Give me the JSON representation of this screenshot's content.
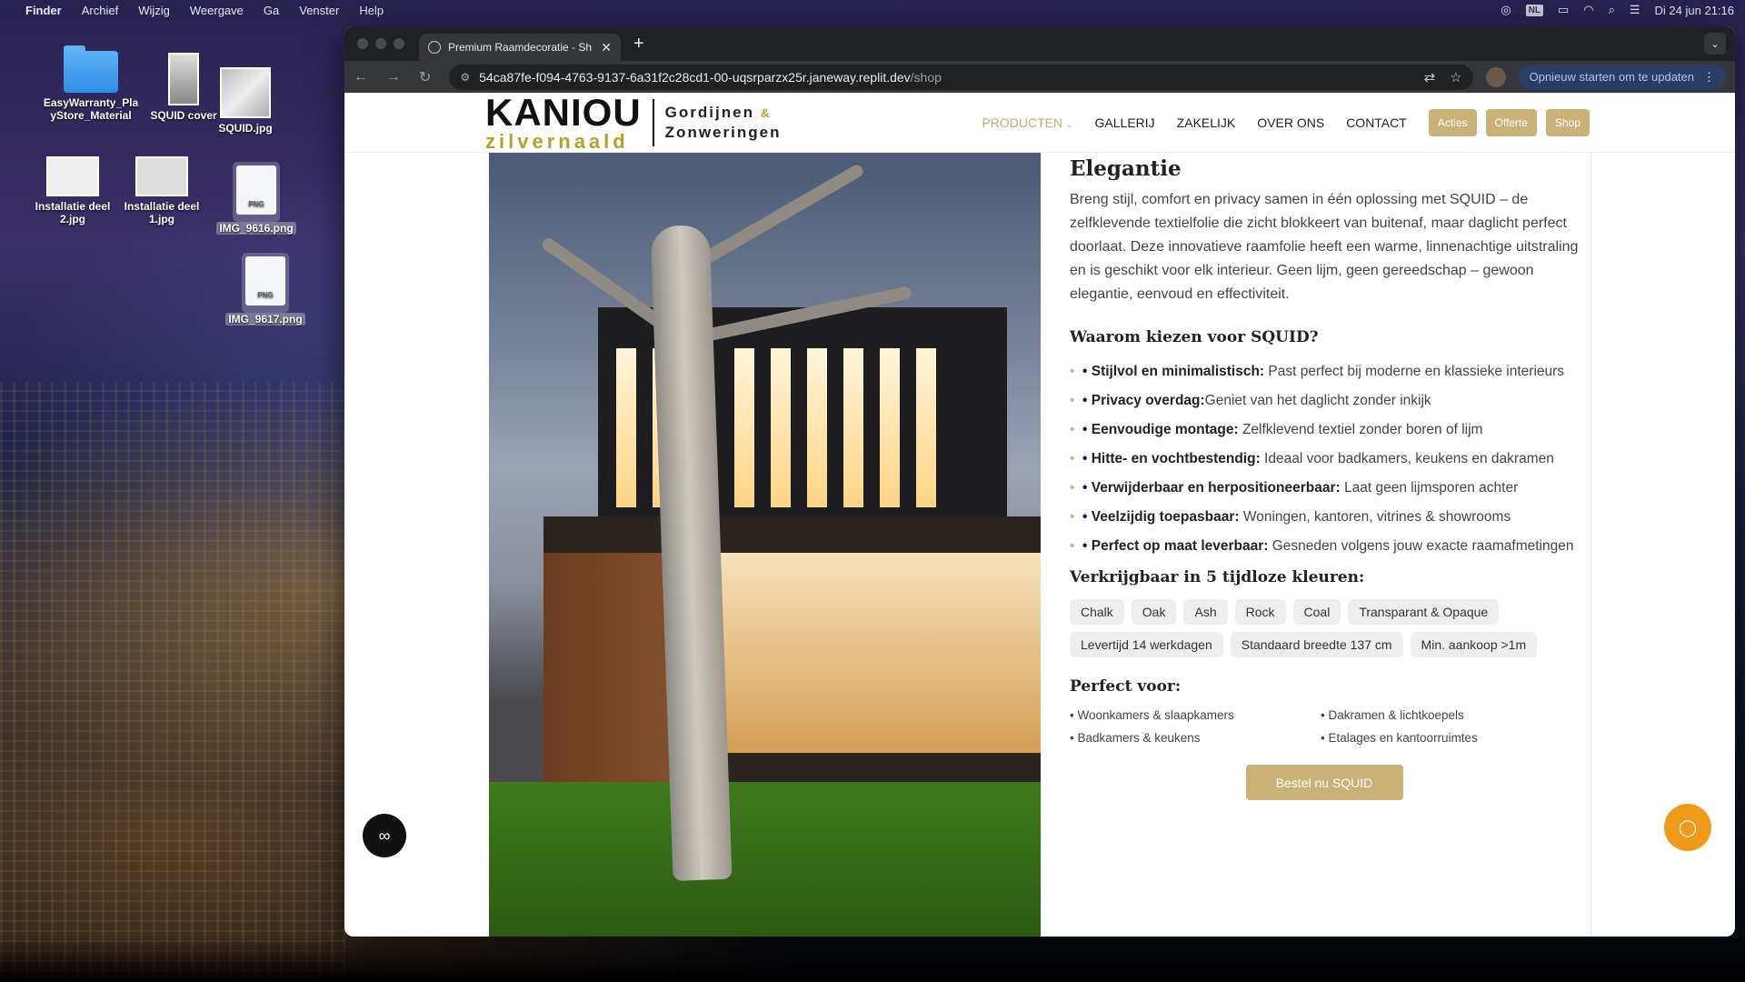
{
  "menubar": {
    "app": "Finder",
    "items": [
      "Archief",
      "Wijzig",
      "Weergave",
      "Ga",
      "Venster",
      "Help"
    ],
    "lang": "NL",
    "datetime": "Di 24 jun  21:16"
  },
  "desktop_icons": [
    {
      "label": "EasyWarranty_PlayStore_Material",
      "label_line1": "EasyWarranty_Pla",
      "label_line2": "yStore_Material"
    },
    {
      "label": "SQUID cover"
    },
    {
      "label": "SQUID.jpg"
    },
    {
      "label": "Installatie deel 2.jpg",
      "label_line1": "Installatie deel",
      "label_line2": "2.jpg"
    },
    {
      "label": "Installatie deel 1.jpg",
      "label_line1": "Installatie deel",
      "label_line2": "1.jpg"
    },
    {
      "label": "IMG_9616.png",
      "type": "PNG"
    },
    {
      "label": "IMG_9617.png",
      "type": "PNG"
    }
  ],
  "browser": {
    "tab_title": "Premium Raamdecoratie - Sh",
    "url_host": "54ca87fe-f094-4763-9137-6a31f2c28cd1-00-uqsrparzx25r.janeway.replit.dev",
    "url_path": "/shop",
    "update_label": "Opnieuw starten om te updaten"
  },
  "site": {
    "logo_main": "KANIOU",
    "logo_sub": "zilvernaald",
    "logo_right1": "Gordijnen",
    "logo_amp": "&",
    "logo_right2": "Zonweringen",
    "nav": [
      "PRODUCTEN",
      "GALLERIJ",
      "ZAKELIJK",
      "OVER ONS",
      "CONTACT"
    ],
    "buttons": [
      "Acties",
      "Offerte",
      "Shop"
    ]
  },
  "product": {
    "title": "Elegantie",
    "intro": "Breng stijl, comfort en privacy samen in één oplossing met SQUID – de zelfklevende textielfolie die zicht blokkeert van buitenaf, maar daglicht perfect doorlaat. Deze innovatieve raamfolie heeft een warme, linnenachtige uitstraling en is geschikt voor elk interieur. Geen lijm, geen gereedschap – gewoon elegantie, eenvoud en effectiviteit.",
    "why_heading": "Waarom kiezen voor SQUID?",
    "benefits": [
      {
        "label": "• Stijlvol en minimalistisch:",
        "text": " Past perfect bij moderne en klassieke interieurs"
      },
      {
        "label": "• Privacy overdag:",
        "text": "Geniet van het daglicht zonder inkijk"
      },
      {
        "label": "• Eenvoudige montage:",
        "text": " Zelfklevend textiel zonder boren of lijm"
      },
      {
        "label": "• Hitte- en vochtbestendig:",
        "text": " Ideaal voor badkamers, keukens en dakramen"
      },
      {
        "label": "• Verwijderbaar en herpositioneerbaar:",
        "text": " Laat geen lijmsporen achter"
      },
      {
        "label": "• Veelzijdig toepasbaar:",
        "text": " Woningen, kantoren, vitrines & showrooms"
      },
      {
        "label": "• Perfect op maat leverbaar:",
        "text": " Gesneden volgens jouw exacte raamafmetingen"
      }
    ],
    "colors_heading": "Verkrijgbaar in 5 tijdloze kleuren:",
    "chips": [
      "Chalk",
      "Oak",
      "Ash",
      "Rock",
      "Coal",
      "Transparant & Opaque",
      "Levertijd 14 werkdagen",
      "Standaard breedte 137 cm",
      "Min. aankoop >1m"
    ],
    "perfect_heading": "Perfect voor:",
    "perfect_for": [
      "• Woonkamers & slaapkamers",
      "• Dakramen & lichtkoepels",
      "• Badkamers & keukens",
      "• Etalages en kantoorruimtes"
    ],
    "cta": "Bestel nu SQUID"
  }
}
